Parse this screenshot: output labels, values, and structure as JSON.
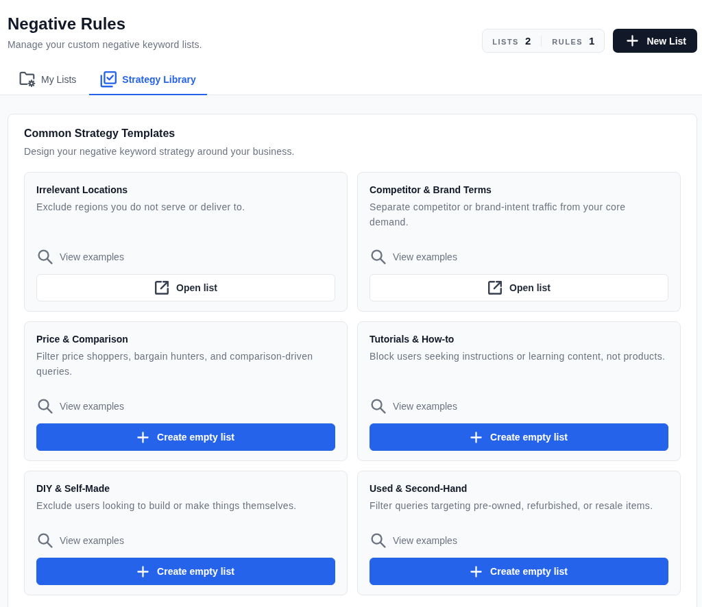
{
  "page": {
    "title": "Negative Rules",
    "subtitle": "Manage your custom negative keyword lists."
  },
  "stats": [
    {
      "label": "LISTS",
      "value": "2"
    },
    {
      "label": "RULES",
      "value": "1"
    }
  ],
  "new_list_button": {
    "label": "New List"
  },
  "tabs": [
    {
      "label": "My Lists",
      "selected": false
    },
    {
      "label": "Strategy Library",
      "selected": true
    }
  ],
  "templates": {
    "title": "Common Strategy Templates",
    "subtitle": "Design your negative keyword strategy around your business.",
    "cards": [
      {
        "title": "Irrelevant Locations",
        "description": "Exclude regions you do not serve or deliver to.",
        "link": "View examples",
        "action": {
          "kind": "open",
          "label": "Open list"
        }
      },
      {
        "title": "Competitor & Brand Terms",
        "description": "Separate competitor or brand-intent traffic from your core demand.",
        "link": "View examples",
        "action": {
          "kind": "open",
          "label": "Open list"
        }
      },
      {
        "title": "Price & Comparison",
        "description": "Filter price shoppers, bargain hunters, and comparison-driven queries.",
        "link": "View examples",
        "action": {
          "kind": "create",
          "label": "Create empty list"
        }
      },
      {
        "title": "Tutorials & How-to",
        "description": "Block users seeking instructions or learning content, not products.",
        "link": "View examples",
        "action": {
          "kind": "create",
          "label": "Create empty list"
        }
      },
      {
        "title": "DIY & Self-Made",
        "description": "Exclude users looking to build or make things themselves.",
        "link": "View examples",
        "action": {
          "kind": "create",
          "label": "Create empty list"
        }
      },
      {
        "title": "Used & Second-Hand",
        "description": "Filter queries targeting pre-owned, refurbished, or resale items.",
        "link": "View examples",
        "action": {
          "kind": "create",
          "label": "Create empty list"
        }
      }
    ]
  }
}
